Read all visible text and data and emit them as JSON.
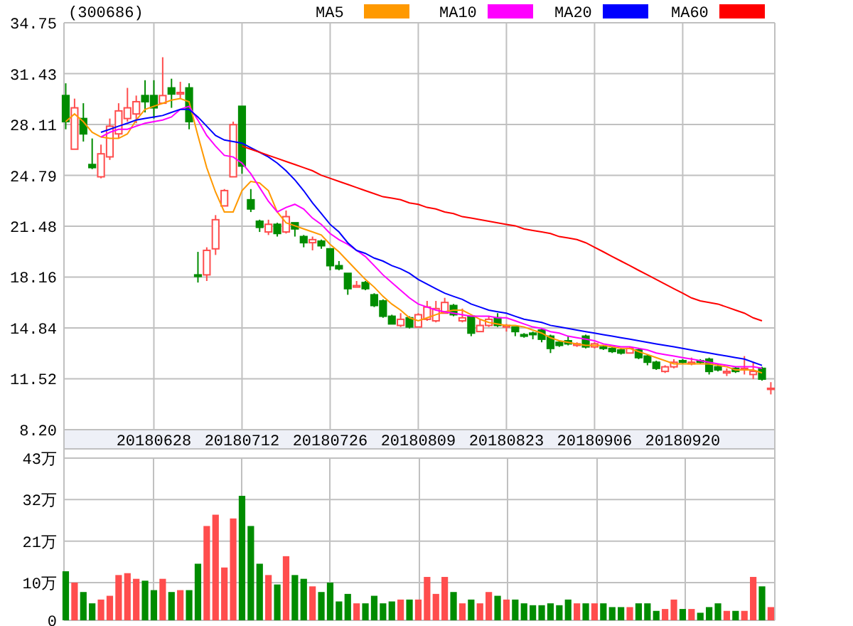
{
  "price_chart": {
    "chart_data": {
      "type": "candlestick",
      "title": "(300686)",
      "grid": true,
      "categories": [
        null,
        null,
        null,
        null,
        null,
        null,
        null,
        null,
        null,
        null,
        "20180628",
        null,
        null,
        null,
        null,
        null,
        null,
        null,
        null,
        null,
        "20180712",
        null,
        null,
        null,
        null,
        null,
        null,
        null,
        null,
        null,
        "20180726",
        null,
        null,
        null,
        null,
        null,
        null,
        null,
        null,
        null,
        "20180809",
        null,
        null,
        null,
        null,
        null,
        null,
        null,
        null,
        null,
        "20180823",
        null,
        null,
        null,
        null,
        null,
        null,
        null,
        null,
        null,
        "20180906",
        null,
        null,
        null,
        null,
        null,
        null,
        null,
        null,
        null,
        "20180920",
        null,
        null,
        null,
        null,
        null,
        null,
        null,
        null,
        null,
        null
      ],
      "ohlc": [
        [
          30.0,
          30.8,
          27.8,
          28.3
        ],
        [
          26.5,
          29.8,
          26.5,
          29.2
        ],
        [
          28.5,
          29.5,
          27.0,
          27.5
        ],
        [
          25.5,
          27.2,
          25.2,
          25.3
        ],
        [
          24.7,
          26.8,
          24.6,
          26.2
        ],
        [
          26.0,
          28.5,
          25.8,
          28.0
        ],
        [
          27.5,
          29.5,
          27.2,
          29.0
        ],
        [
          28.5,
          30.5,
          28.3,
          29.2
        ],
        [
          28.8,
          30.0,
          28.2,
          29.6
        ],
        [
          30.0,
          31.0,
          28.9,
          29.6
        ],
        [
          30.0,
          31.0,
          28.5,
          29.2
        ],
        [
          29.5,
          32.5,
          29.5,
          30.0
        ],
        [
          30.5,
          31.1,
          29.2,
          30.1
        ],
        [
          30.1,
          30.9,
          29.8,
          30.2
        ],
        [
          30.5,
          30.8,
          27.8,
          28.3
        ],
        [
          18.3,
          19.8,
          17.8,
          18.2
        ],
        [
          18.3,
          20.1,
          17.9,
          19.9
        ],
        [
          20.0,
          22.2,
          19.6,
          21.9
        ],
        [
          22.8,
          23.9,
          22.8,
          23.8
        ],
        [
          24.7,
          28.3,
          24.7,
          28.1
        ],
        [
          29.3,
          29.3,
          24.9,
          25.4
        ],
        [
          23.2,
          23.9,
          22.4,
          22.6
        ],
        [
          21.8,
          21.9,
          21.1,
          21.4
        ],
        [
          21.1,
          21.9,
          20.9,
          21.6
        ],
        [
          21.6,
          21.7,
          20.8,
          21.0
        ],
        [
          21.1,
          22.5,
          21.0,
          22.1
        ],
        [
          21.7,
          21.7,
          20.8,
          21.3
        ],
        [
          20.8,
          20.9,
          20.1,
          20.4
        ],
        [
          20.4,
          20.8,
          19.9,
          20.6
        ],
        [
          20.5,
          20.6,
          20.0,
          20.2
        ],
        [
          20.0,
          20.0,
          18.6,
          18.9
        ],
        [
          18.9,
          19.2,
          18.6,
          18.7
        ],
        [
          18.4,
          18.4,
          17.0,
          17.4
        ],
        [
          17.5,
          17.9,
          17.5,
          17.6
        ],
        [
          17.8,
          17.9,
          17.3,
          17.4
        ],
        [
          17.0,
          17.1,
          16.2,
          16.3
        ],
        [
          16.6,
          16.7,
          15.5,
          15.6
        ],
        [
          15.6,
          15.7,
          15.1,
          15.1
        ],
        [
          15.0,
          15.8,
          14.9,
          15.4
        ],
        [
          15.5,
          15.6,
          14.8,
          14.9
        ],
        [
          14.9,
          15.8,
          14.9,
          15.7
        ],
        [
          15.4,
          16.6,
          15.3,
          16.2
        ],
        [
          15.3,
          16.6,
          15.2,
          16.1
        ],
        [
          15.8,
          16.8,
          15.8,
          16.5
        ],
        [
          16.3,
          16.4,
          15.6,
          15.7
        ],
        [
          15.3,
          16.1,
          15.2,
          15.5
        ],
        [
          15.6,
          15.6,
          14.3,
          14.5
        ],
        [
          14.6,
          15.4,
          14.6,
          15.0
        ],
        [
          15.0,
          15.6,
          14.9,
          15.4
        ],
        [
          15.5,
          15.8,
          14.9,
          15.0
        ],
        [
          14.9,
          15.1,
          14.6,
          15.0
        ],
        [
          14.9,
          14.9,
          14.3,
          14.6
        ],
        [
          14.4,
          14.5,
          14.2,
          14.3
        ],
        [
          14.5,
          14.6,
          14.1,
          14.4
        ],
        [
          14.7,
          14.8,
          13.9,
          14.1
        ],
        [
          14.3,
          14.4,
          13.2,
          13.5
        ],
        [
          13.9,
          14.0,
          13.6,
          13.7
        ],
        [
          14.0,
          14.3,
          13.7,
          13.8
        ],
        [
          13.7,
          13.9,
          13.6,
          13.8
        ],
        [
          14.3,
          14.4,
          13.5,
          13.6
        ],
        [
          13.6,
          13.9,
          13.5,
          13.8
        ],
        [
          13.6,
          13.7,
          13.4,
          13.5
        ],
        [
          13.5,
          13.6,
          13.2,
          13.3
        ],
        [
          13.4,
          13.5,
          13.1,
          13.2
        ],
        [
          13.2,
          13.6,
          13.2,
          13.5
        ],
        [
          13.4,
          13.5,
          12.8,
          12.9
        ],
        [
          13.0,
          13.1,
          12.4,
          12.6
        ],
        [
          12.6,
          12.7,
          12.1,
          12.2
        ],
        [
          12.0,
          12.4,
          11.9,
          12.3
        ],
        [
          12.3,
          12.8,
          12.2,
          12.6
        ],
        [
          12.7,
          12.8,
          12.5,
          12.6
        ],
        [
          12.5,
          12.9,
          12.4,
          12.6
        ],
        [
          12.7,
          12.8,
          12.5,
          12.6
        ],
        [
          12.8,
          12.9,
          11.8,
          12.0
        ],
        [
          12.3,
          12.5,
          12.0,
          12.1
        ],
        [
          11.9,
          12.2,
          11.7,
          12.0
        ],
        [
          12.2,
          12.3,
          11.9,
          12.0
        ],
        [
          12.2,
          13.0,
          11.8,
          12.2
        ],
        [
          11.8,
          12.6,
          11.5,
          12.0
        ],
        [
          12.2,
          12.3,
          11.4,
          11.5
        ],
        [
          10.9,
          11.3,
          10.5,
          10.9
        ]
      ],
      "ylim": [
        8.2,
        34.75
      ],
      "yticks": [
        {
          "value": 34.75,
          "label": "34.75"
        },
        {
          "value": 31.43,
          "label": "31.43"
        },
        {
          "value": 28.11,
          "label": "28.11"
        },
        {
          "value": 24.79,
          "label": "24.79"
        },
        {
          "value": 21.48,
          "label": "21.48"
        },
        {
          "value": 18.16,
          "label": "18.16"
        },
        {
          "value": 14.84,
          "label": "14.84"
        },
        {
          "value": 11.52,
          "label": "11.52"
        },
        {
          "value": 8.2,
          "label": "8.20"
        }
      ]
    }
  },
  "ma_chart": {
    "chart_data": {
      "type": "line",
      "ylim": [
        8.2,
        34.75
      ],
      "series": [
        {
          "name": "MA5",
          "color": "#ff9900",
          "values": [
            28.3,
            28.8,
            28.3,
            27.6,
            27.3,
            27.2,
            27.2,
            27.5,
            28.4,
            29.1,
            29.3,
            29.5,
            29.7,
            29.8,
            29.6,
            27.4,
            25.3,
            23.7,
            22.4,
            22.4,
            23.8,
            24.4,
            24.3,
            23.8,
            22.4,
            21.7,
            21.5,
            21.3,
            21.1,
            20.9,
            20.3,
            19.8,
            19.2,
            18.6,
            18.0,
            17.5,
            16.9,
            16.4,
            16.0,
            15.5,
            15.3,
            15.5,
            15.7,
            15.9,
            16.0,
            16.0,
            15.7,
            15.4,
            15.2,
            15.1,
            15.0,
            15.0,
            14.9,
            14.7,
            14.5,
            14.2,
            14.0,
            13.9,
            13.8,
            13.7,
            13.7,
            13.7,
            13.6,
            13.5,
            13.5,
            13.3,
            13.1,
            12.9,
            12.7,
            12.5,
            12.5,
            12.5,
            12.5,
            12.5,
            12.4,
            12.3,
            12.1,
            12.1,
            12.1,
            11.9,
            null
          ]
        },
        {
          "name": "MA10",
          "color": "#ff00ff",
          "values": [
            null,
            null,
            null,
            null,
            27.3,
            27.6,
            27.8,
            27.8,
            28.0,
            28.2,
            28.3,
            28.4,
            28.6,
            29.1,
            29.3,
            28.4,
            27.4,
            26.7,
            26.1,
            26.0,
            25.6,
            24.9,
            24.0,
            23.1,
            22.4,
            22.7,
            22.9,
            22.6,
            22.0,
            21.6,
            21.0,
            20.6,
            20.3,
            19.9,
            19.5,
            18.9,
            18.3,
            17.8,
            17.3,
            16.8,
            16.4,
            16.2,
            16.0,
            15.9,
            15.8,
            15.7,
            15.6,
            15.6,
            15.6,
            15.5,
            15.5,
            15.3,
            15.1,
            14.9,
            14.8,
            14.6,
            14.5,
            14.3,
            14.2,
            14.1,
            14.0,
            13.8,
            13.7,
            13.6,
            13.6,
            13.5,
            13.4,
            13.2,
            13.1,
            13.0,
            12.9,
            12.8,
            12.7,
            12.6,
            12.5,
            12.4,
            12.3,
            12.3,
            12.3,
            12.2,
            null
          ]
        },
        {
          "name": "MA20",
          "color": "#0000ff",
          "values": [
            null,
            null,
            null,
            null,
            27.6,
            27.8,
            28.0,
            28.2,
            28.4,
            28.5,
            28.6,
            28.7,
            28.9,
            29.1,
            29.1,
            28.6,
            28.0,
            27.4,
            27.1,
            27.0,
            26.9,
            26.6,
            26.3,
            26.0,
            25.6,
            25.1,
            24.5,
            23.8,
            23.0,
            22.3,
            21.6,
            21.1,
            20.4,
            19.9,
            19.7,
            19.4,
            19.2,
            18.9,
            18.7,
            18.4,
            18.0,
            17.7,
            17.4,
            17.1,
            16.9,
            16.7,
            16.4,
            16.2,
            16.0,
            15.9,
            15.8,
            15.6,
            15.4,
            15.3,
            15.2,
            15.0,
            14.9,
            14.8,
            14.7,
            14.6,
            14.5,
            14.4,
            14.3,
            14.2,
            14.1,
            14.0,
            13.9,
            13.8,
            13.7,
            13.6,
            13.5,
            13.4,
            13.3,
            13.2,
            13.1,
            13.0,
            12.9,
            12.8,
            12.6,
            12.4,
            null
          ]
        },
        {
          "name": "MA60",
          "color": "#ff0000",
          "values": [
            null,
            null,
            null,
            null,
            null,
            null,
            null,
            null,
            null,
            null,
            null,
            null,
            null,
            null,
            null,
            null,
            null,
            null,
            null,
            null,
            26.7,
            26.5,
            26.3,
            26.1,
            25.9,
            25.7,
            25.5,
            25.3,
            25.1,
            24.8,
            24.6,
            24.4,
            24.2,
            24.0,
            23.8,
            23.6,
            23.4,
            23.3,
            23.2,
            23.0,
            22.9,
            22.7,
            22.6,
            22.4,
            22.3,
            22.1,
            22.0,
            21.9,
            21.8,
            21.7,
            21.6,
            21.5,
            21.3,
            21.2,
            21.1,
            21.0,
            20.8,
            20.7,
            20.6,
            20.4,
            20.1,
            19.8,
            19.5,
            19.2,
            18.9,
            18.6,
            18.3,
            18.0,
            17.7,
            17.4,
            17.1,
            16.8,
            16.6,
            16.5,
            16.4,
            16.2,
            16.0,
            15.8,
            15.5,
            15.3,
            null
          ]
        }
      ]
    }
  },
  "volume_chart": {
    "chart_data": {
      "type": "bar",
      "grid": true,
      "ylim": [
        0,
        43
      ],
      "values": [
        13,
        10,
        7.5,
        4.5,
        5.5,
        6.5,
        12,
        12.5,
        11,
        10.5,
        8,
        11,
        7.5,
        8,
        8,
        15,
        25,
        28,
        14,
        27,
        33,
        25,
        15,
        12,
        9.5,
        17,
        12,
        11,
        9,
        7.5,
        10,
        5,
        7,
        4.5,
        4.5,
        6.5,
        4.5,
        5,
        5.5,
        5.5,
        5.5,
        11.5,
        7,
        11.5,
        7.5,
        4.5,
        5.5,
        4.5,
        7.5,
        6.5,
        5.5,
        5.5,
        4.5,
        4,
        4,
        4.5,
        4,
        5.5,
        4.5,
        4.5,
        4.5,
        4.5,
        3.5,
        3.5,
        3.5,
        4.5,
        4.5,
        2.5,
        3,
        5.5,
        3,
        3,
        2,
        3.5,
        4.5,
        2.5,
        2.5,
        2.5,
        11.5,
        9,
        3.5
      ],
      "yticks": [
        {
          "value": 43,
          "label": "43万"
        },
        {
          "value": 32,
          "label": "32万"
        },
        {
          "value": 21,
          "label": "21万"
        },
        {
          "value": 10,
          "label": "10万"
        },
        {
          "value": 0,
          "label": "0"
        }
      ]
    }
  }
}
